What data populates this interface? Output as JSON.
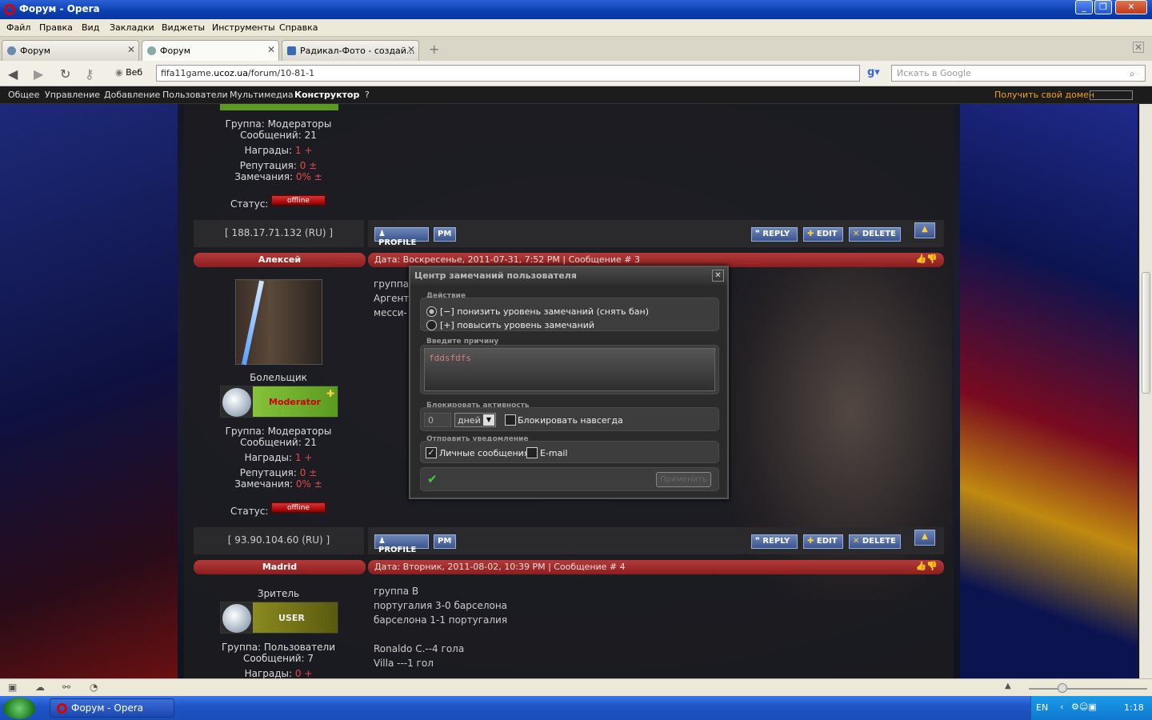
{
  "window": {
    "title": "Форум - Opera"
  },
  "menu": [
    "Файл",
    "Правка",
    "Вид",
    "Закладки",
    "Виджеты",
    "Инструменты",
    "Справка"
  ],
  "tabs": [
    {
      "label": "Форум"
    },
    {
      "label": "Форум"
    },
    {
      "label": "Радикал-Фото - создай…"
    }
  ],
  "nav": {
    "web": "Веб",
    "url_prefix": "fifa11game.",
    "url_domain": "ucoz.ua",
    "url_path": "/forum/10-81-1",
    "search_placeholder": "Искать в Google"
  },
  "ucoz": {
    "items": [
      "Общее",
      "Управление",
      "Добавление",
      "Пользователи",
      "Мультимедиа",
      "Конструктор",
      "?"
    ],
    "domain_link": "Получить свой домен"
  },
  "post0": {
    "group": "Группа: Модераторы",
    "messages": "Сообщений: 21",
    "awards_label": "Награды:",
    "awards": "1",
    "plus": "+",
    "rep_label": "Репутация:",
    "rep": "0",
    "pm": "±",
    "warn_label": "Замечания:",
    "warn": "0%",
    "status_label": "Статус:",
    "status": "offline",
    "ip": "[ 188.17.71.132 (RU) ]"
  },
  "buttons": {
    "profile": "PROFILE",
    "pm": "PM",
    "reply": "REPLY",
    "edit": "EDIT",
    "delete": "DELETE"
  },
  "post1": {
    "author": "Алексей",
    "meta": "Дата: Воскресенье, 2011-07-31, 7:52 PM | Сообщение # 3",
    "text": [
      "группа",
      "Аргент",
      "месси-"
    ],
    "rank": "Болельщик",
    "badge": "Moderator",
    "group": "Группа: Модераторы",
    "messages": "Сообщений: 21",
    "awards": "1",
    "rep": "0",
    "warn": "0%",
    "status": "offline",
    "ip": "[ 93.90.104.60 (RU) ]"
  },
  "post2": {
    "author": "Madrid",
    "meta": "Дата: Вторник, 2011-08-02, 10:39 PM | Сообщение # 4",
    "text": [
      "группа В",
      "португалия 3-0 барселона",
      "барселона 1-1 португалия",
      "",
      "Ronaldo C.--4 гола",
      "Villa ---1 гол"
    ],
    "rank": "Зритель",
    "badge": "USER",
    "group": "Группа: Пользователи",
    "messages": "Сообщений: 7",
    "awards_label": "Награды:",
    "awards": "0",
    "plus": "+"
  },
  "modal": {
    "title": "Центр замечаний пользователя",
    "action_label": "Действие",
    "opt1": "[−] понизить уровень замечаний (снять бан)",
    "opt2": "[+] повысить уровень замечаний",
    "reason_label": "Введите причину",
    "reason_value": "fddsfdfs",
    "block_label": "Блокировать активность",
    "block_value": "0",
    "block_unit": "дней",
    "block_forever": "Блокировать навсегда",
    "notify_label": "Отправить уведомление",
    "notify_pm": "Личные сообщения",
    "notify_email": "E-mail",
    "apply": "Применить"
  },
  "taskbar": {
    "app": "Форум - Opera",
    "lang": "EN",
    "time": "1:18"
  }
}
